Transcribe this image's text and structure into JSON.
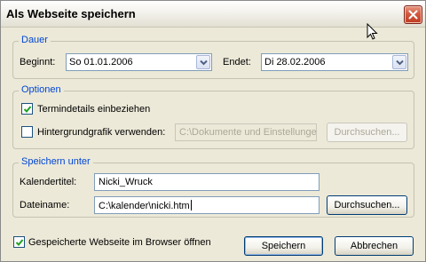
{
  "window": {
    "title": "Als Webseite speichern"
  },
  "groups": {
    "dauer": {
      "legend": "Dauer",
      "begin_label": "Beginnt:",
      "begin_value": "So 01.01.2006",
      "end_label": "Endet:",
      "end_value": "Di 28.02.2006"
    },
    "optionen": {
      "legend": "Optionen",
      "termindetails_label": "Termindetails einbeziehen",
      "termindetails_checked": true,
      "hintergrund_label": "Hintergrundgrafik verwenden:",
      "hintergrund_checked": false,
      "hintergrund_path": "C:\\Dokumente und Einstellunge",
      "hintergrund_browse": "Durchsuchen..."
    },
    "speichern_unter": {
      "legend": "Speichern unter",
      "kalendertitel_label": "Kalendertitel:",
      "kalendertitel_value": "Nicki_Wruck",
      "dateiname_label": "Dateiname:",
      "dateiname_value": "C:\\kalender\\nicki.htm",
      "browse": "Durchsuchen..."
    }
  },
  "footer": {
    "open_in_browser_label": "Gespeicherte Webseite im Browser öffnen",
    "open_in_browser_checked": true,
    "save_button": "Speichern",
    "cancel_button": "Abbrechen"
  },
  "icons": {
    "close": "close-icon",
    "dropdown": "chevron-down-icon",
    "checkmark": "checkmark-icon",
    "cursor": "mouse-cursor-icon"
  },
  "colors": {
    "legend": "#0046d5",
    "close_button": "#d2593f",
    "checkmark": "#21a121"
  }
}
